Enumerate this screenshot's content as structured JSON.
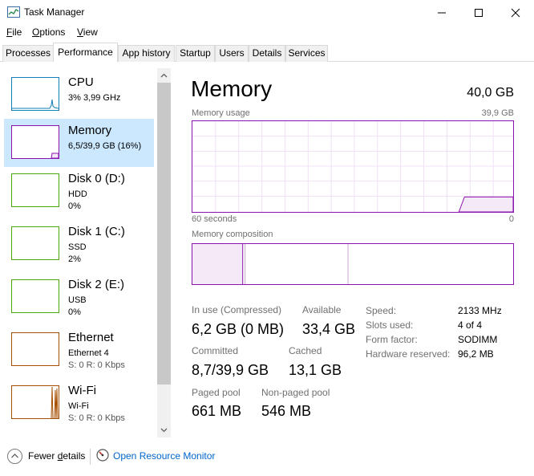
{
  "window": {
    "title": "Task Manager"
  },
  "menu": {
    "file": {
      "u": "F",
      "rest": "ile"
    },
    "options": {
      "u": "O",
      "rest": "ptions"
    },
    "view": {
      "u": "V",
      "rest": "iew"
    }
  },
  "tabs": [
    "Processes",
    "Performance",
    "App history",
    "Startup",
    "Users",
    "Details",
    "Services"
  ],
  "sidebar": {
    "items": [
      {
        "name": "CPU",
        "sub1": "3%  3,99 GHz",
        "sub2": ""
      },
      {
        "name": "Memory",
        "sub1": "6,5/39,9 GB (16%)",
        "sub2": ""
      },
      {
        "name": "Disk 0 (D:)",
        "sub1": "HDD",
        "sub2": "0%"
      },
      {
        "name": "Disk 1 (C:)",
        "sub1": "SSD",
        "sub2": "2%"
      },
      {
        "name": "Disk 2 (E:)",
        "sub1": "USB",
        "sub2": "0%"
      },
      {
        "name": "Ethernet",
        "sub1": "Ethernet 4",
        "sub2": "S: 0  R: 0 Kbps"
      },
      {
        "name": "Wi-Fi",
        "sub1": "Wi-Fi",
        "sub2": "S: 0  R: 0 Kbps"
      }
    ]
  },
  "main": {
    "title": "Memory",
    "total": "40,0 GB",
    "usage_label": "Memory usage",
    "usage_max": "39,9 GB",
    "axis_left": "60 seconds",
    "axis_right": "0",
    "composition_label": "Memory composition",
    "stats": {
      "in_use_label": "In use (Compressed)",
      "in_use_value": "6,2 GB (0 MB)",
      "available_label": "Available",
      "available_value": "33,4 GB",
      "committed_label": "Committed",
      "committed_value": "8,7/39,9 GB",
      "cached_label": "Cached",
      "cached_value": "13,1 GB",
      "paged_label": "Paged pool",
      "paged_value": "661 MB",
      "nonpaged_label": "Non-paged pool",
      "nonpaged_value": "546 MB"
    },
    "details": {
      "speed_label": "Speed:",
      "speed_value": "2133 MHz",
      "slots_label": "Slots used:",
      "slots_value": "4 of 4",
      "form_label": "Form factor:",
      "form_value": "SODIMM",
      "reserved_label": "Hardware reserved:",
      "reserved_value": "96,2 MB"
    }
  },
  "footer": {
    "fewer_u": "d",
    "fewer_pre": "Fewer ",
    "fewer_post": "etails",
    "resource_monitor": "Open Resource Monitor"
  },
  "colors": {
    "memory": "#8b12ae",
    "cpu": "#117dbb",
    "disk": "#4da60c",
    "network": "#a74f01",
    "selected": "#cce8ff",
    "link": "#0066cc"
  }
}
